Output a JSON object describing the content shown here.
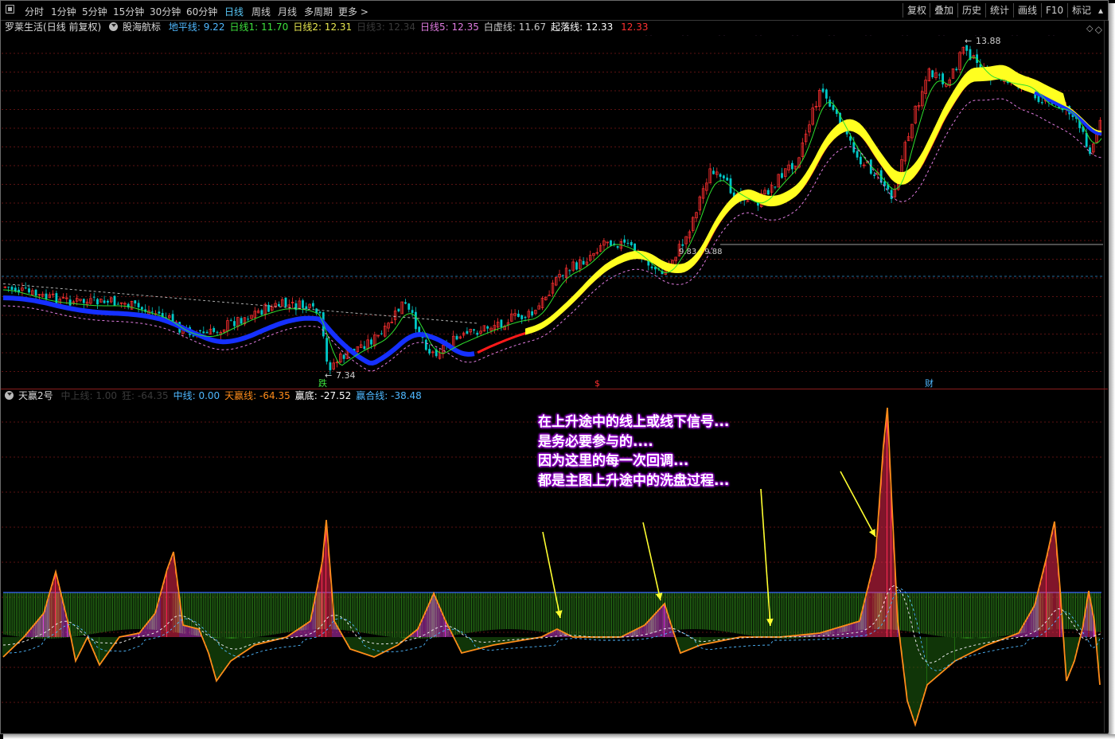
{
  "toolbar": {
    "periods": [
      "分时",
      "1分钟",
      "5分钟",
      "15分钟",
      "30分钟",
      "60分钟",
      "日线",
      "周线",
      "月线",
      "多周期",
      "更多"
    ],
    "active_period": "日线",
    "right_buttons": [
      "复权",
      "叠加",
      "历史",
      "统计",
      "画线",
      "F10",
      "标记"
    ]
  },
  "main_chart": {
    "stock_name": "罗莱生活",
    "mode": "(日线 前复权)",
    "indicator_name": "股海航标",
    "legend": [
      {
        "label": "地平线:",
        "value": "9.22",
        "color": "#4fb8ff"
      },
      {
        "label": "日线1:",
        "value": "11.70",
        "color": "#3de03d"
      },
      {
        "label": "日线2:",
        "value": "12.31",
        "color": "#e8e850"
      },
      {
        "label": "日线3:",
        "value": "12.34",
        "color": "#3a3a3a"
      },
      {
        "label": "日线5:",
        "value": "12.35",
        "color": "#e07ce0"
      },
      {
        "label": "白虚线:",
        "value": "11.67",
        "color": "#c8c8c8"
      },
      {
        "label": "起落线:",
        "value": "12.33",
        "color": "#ffffff"
      },
      {
        "label": "",
        "value": "12.33",
        "color": "#ff3030"
      }
    ],
    "high_label": "13.88",
    "low_label": "7.34",
    "mid_label": "9.83 - 9.88",
    "markers": [
      {
        "text": "跌",
        "color": "#3de03d"
      },
      {
        "text": "$",
        "color": "#ff3030"
      },
      {
        "text": "财",
        "color": "#4fb8ff"
      }
    ]
  },
  "sub_chart": {
    "indicator_name": "天赢2号",
    "legend": [
      {
        "label": "中上线:",
        "value": "1.00",
        "color": "#3a3a3a"
      },
      {
        "label": "狂:",
        "value": "-64.35",
        "color": "#3a3a3a"
      },
      {
        "label": "中线:",
        "value": "0.00",
        "color": "#4fb8ff"
      },
      {
        "label": "天赢线:",
        "value": "-64.35",
        "color": "#ff8c1a"
      },
      {
        "label": "赢底:",
        "value": "-27.52",
        "color": "#ffffff"
      },
      {
        "label": "赢合线:",
        "value": "-38.48",
        "color": "#4fb8ff"
      }
    ]
  },
  "annotation": {
    "lines": [
      "在上升途中的线上或线下信号...",
      "是务必要参与的....",
      "因为这里的每一次回调...",
      "都是主图上升途中的洗盘过程..."
    ]
  }
}
